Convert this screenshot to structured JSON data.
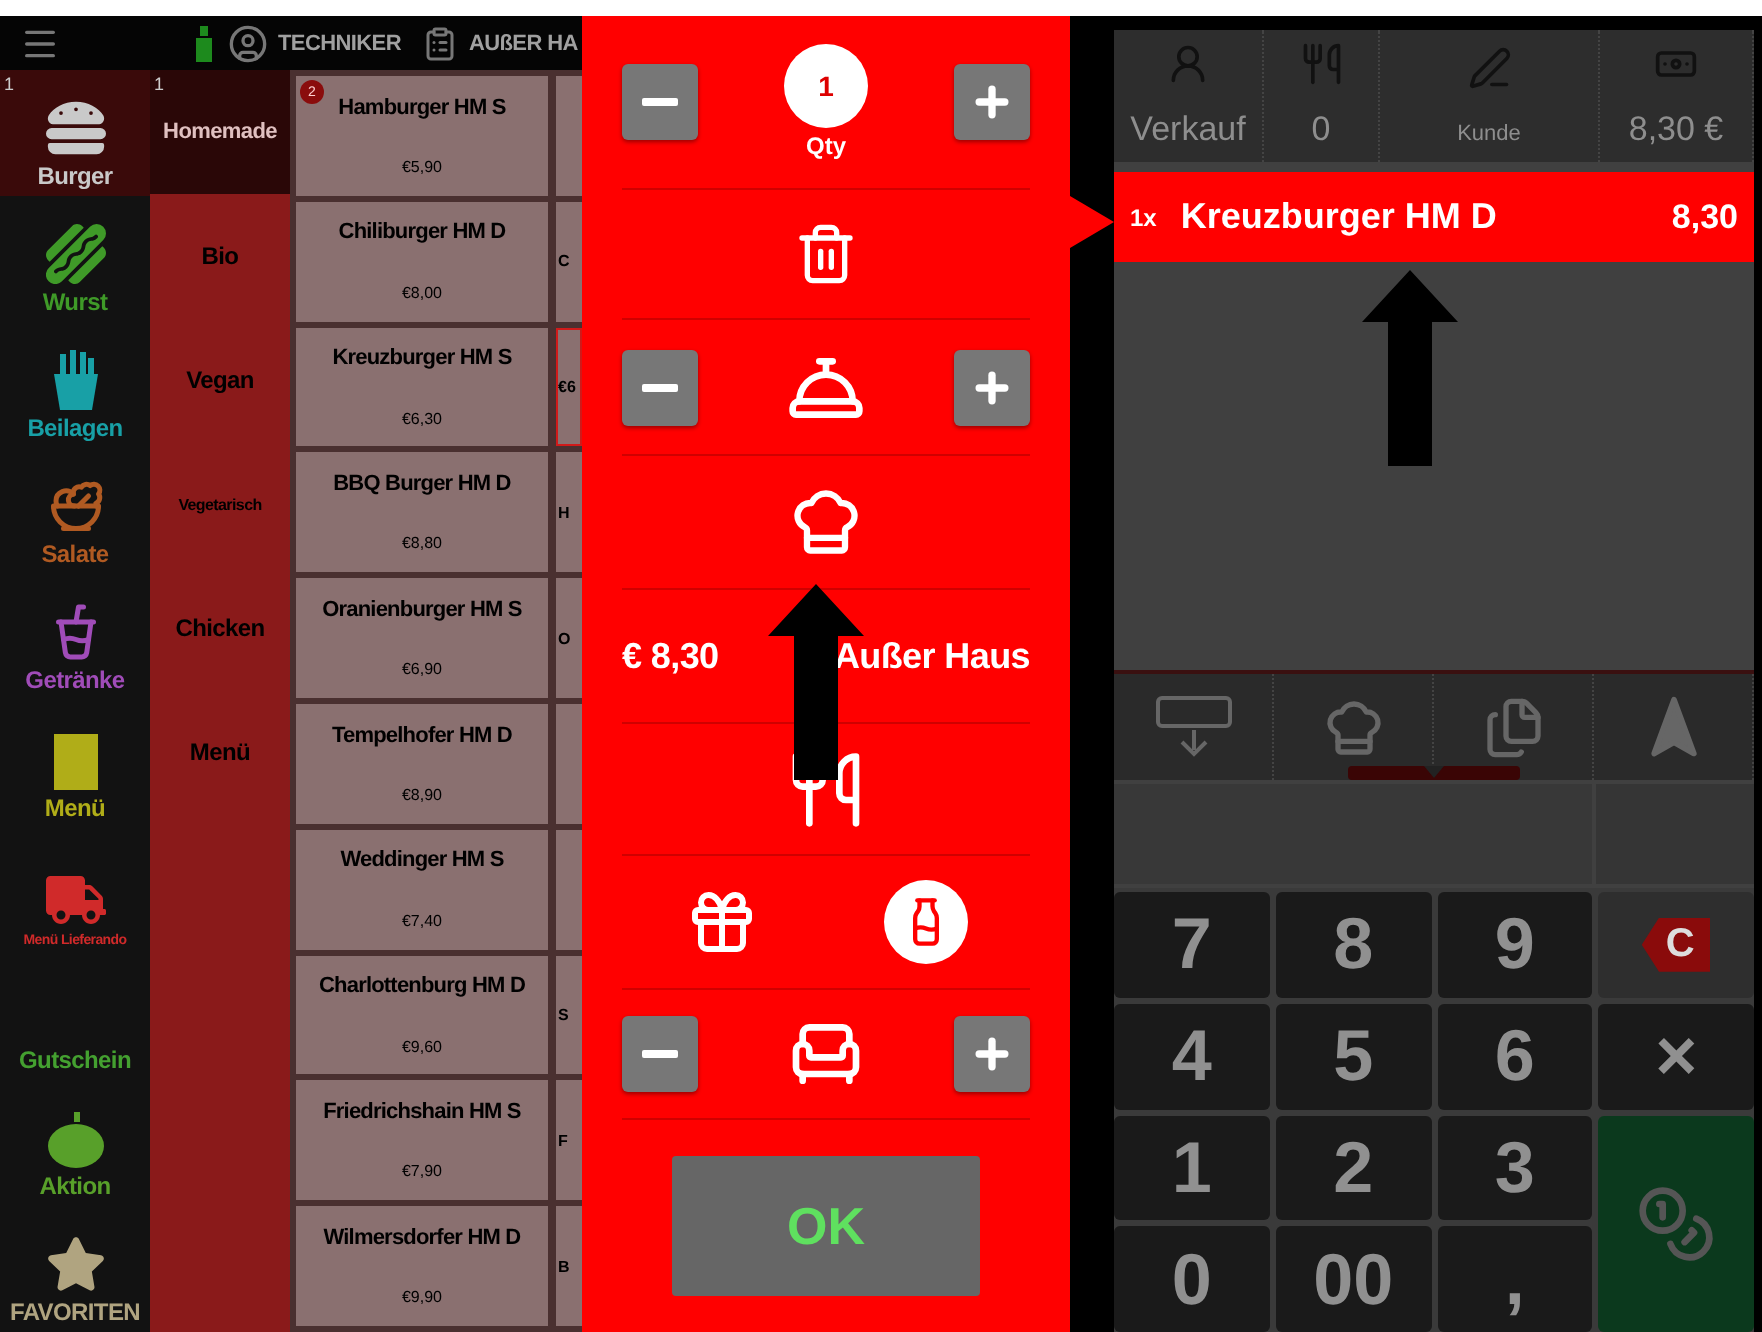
{
  "top_bar": {
    "user": "TECHNIKER",
    "mode": "AUßER HA"
  },
  "categories": [
    {
      "label": "Burger",
      "kind": "burger",
      "color": "#c9c9c9",
      "badge": "1",
      "selected": true
    },
    {
      "label": "Wurst",
      "kind": "sausage",
      "color": "#3f9a28",
      "selected": false
    },
    {
      "label": "Beilagen",
      "kind": "fries",
      "color": "#18a0a6",
      "selected": false
    },
    {
      "label": "Salate",
      "kind": "salad",
      "color": "#b05a22",
      "selected": false
    },
    {
      "label": "Getränke",
      "kind": "drink",
      "color": "#a04cb8",
      "selected": false
    },
    {
      "label": "Menü",
      "kind": "menu",
      "color": "#b0ad18",
      "selected": false
    },
    {
      "label": "Menü Lieferando",
      "kind": "truck",
      "color": "#d02a2a",
      "selected": false
    },
    {
      "label": "Gutschein",
      "kind": "none",
      "color": "#44a030",
      "selected": false
    },
    {
      "label": "Aktion",
      "kind": "pumpkin",
      "color": "#58a02a",
      "selected": false
    },
    {
      "label": "FAVORITEN",
      "kind": "star",
      "color": "#b0a480",
      "selected": false
    }
  ],
  "subcategories": [
    {
      "label": "Homemade",
      "badge": "1",
      "selected": true
    },
    {
      "label": "Bio",
      "selected": false
    },
    {
      "label": "Vegan",
      "selected": false
    },
    {
      "label": "Vegetarisch",
      "selected": false
    },
    {
      "label": "Chicken",
      "selected": false
    },
    {
      "label": "Menü",
      "selected": false
    }
  ],
  "products": [
    {
      "name": "Hamburger HM S",
      "price": "€5,90",
      "badge": "2",
      "next": {
        "selected": false
      }
    },
    {
      "name": "Chiliburger HM D",
      "price": "€8,00",
      "next": {
        "text": "C",
        "selected": false
      }
    },
    {
      "name": "Kreuzburger HM S",
      "price": "€6,30",
      "next": {
        "text": "€6",
        "selected": true
      }
    },
    {
      "name": "BBQ Burger HM D",
      "price": "€8,80",
      "next": {
        "text": "H",
        "selected": false
      }
    },
    {
      "name": "Oranienburger HM S",
      "price": "€6,90",
      "next": {
        "text": "O",
        "selected": false
      }
    },
    {
      "name": "Tempelhofer HM D",
      "price": "€8,90",
      "next": {
        "selected": false
      }
    },
    {
      "name": "Weddinger HM S",
      "price": "€7,40",
      "next": {
        "selected": false
      }
    },
    {
      "name": "Charlottenburg HM D",
      "price": "€9,60",
      "next": {
        "text": "S",
        "selected": false
      }
    },
    {
      "name": "Friedrichshain HM S",
      "price": "€7,90",
      "next": {
        "text": "F",
        "selected": false
      }
    },
    {
      "name": "Wilmersdorfer HM D",
      "price": "€9,90",
      "next": {
        "text": "B",
        "selected": false
      }
    }
  ],
  "popup": {
    "quantity": "1",
    "quantity_label": "Qty",
    "price": "€ 8,30",
    "takeaway": "Außer Haus",
    "ok": "OK"
  },
  "order": {
    "header": [
      {
        "kind": "sale",
        "label": "Verkauf"
      },
      {
        "kind": "cutlery",
        "label": "0"
      },
      {
        "kind": "customer",
        "label": "Kunde"
      },
      {
        "kind": "cash",
        "label": "8,30 €"
      }
    ],
    "items": [
      {
        "qty": "1x",
        "name": "Kreuzburger HM D",
        "price": "8,30",
        "selected": true
      }
    ]
  },
  "keypad": [
    {
      "kind": "digit",
      "label": "7"
    },
    {
      "kind": "digit",
      "label": "8"
    },
    {
      "kind": "digit",
      "label": "9"
    },
    {
      "kind": "clear",
      "label": "C"
    },
    {
      "kind": "digit",
      "label": "4"
    },
    {
      "kind": "digit",
      "label": "5"
    },
    {
      "kind": "digit",
      "label": "6"
    },
    {
      "kind": "multiply",
      "label": "×"
    },
    {
      "kind": "digit",
      "label": "1"
    },
    {
      "kind": "digit",
      "label": "2"
    },
    {
      "kind": "digit",
      "label": "3"
    },
    {
      "kind": "pay"
    },
    {
      "kind": "digit",
      "label": "0"
    },
    {
      "kind": "digit",
      "label": "00"
    },
    {
      "kind": "digit",
      "label": ","
    }
  ]
}
